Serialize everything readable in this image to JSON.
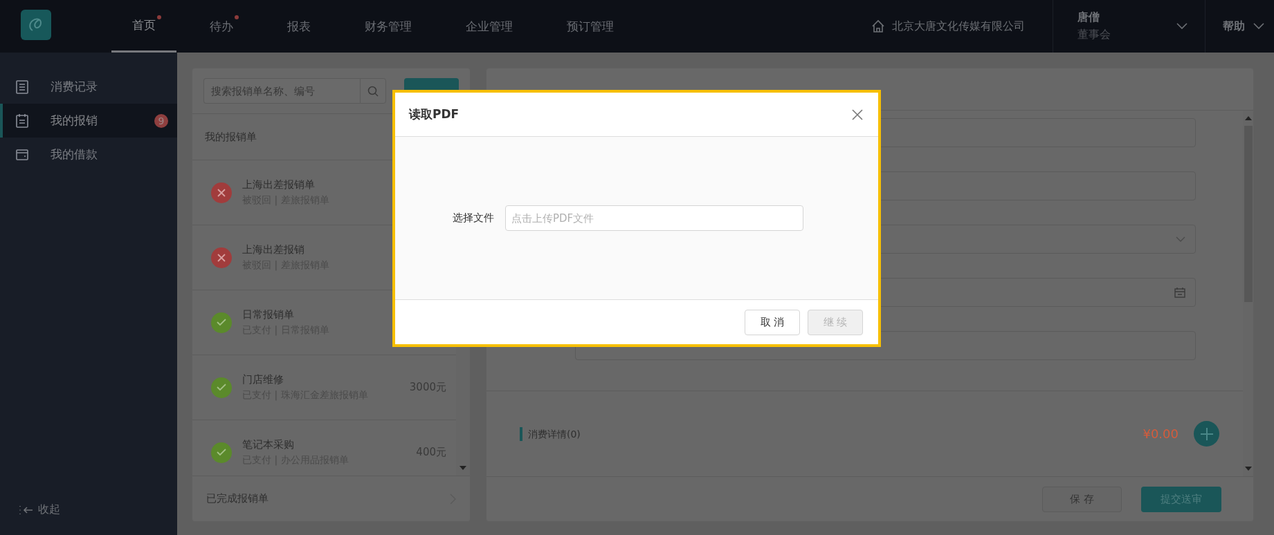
{
  "topbar": {
    "nav": [
      {
        "label": "首页",
        "selected": true,
        "dot": true
      },
      {
        "label": "待办",
        "selected": false,
        "dot": true
      },
      {
        "label": "报表",
        "selected": false,
        "dot": false
      },
      {
        "label": "财务管理",
        "selected": false,
        "dot": false
      },
      {
        "label": "企业管理",
        "selected": false,
        "dot": false
      },
      {
        "label": "预订管理",
        "selected": false,
        "dot": false
      }
    ],
    "company": "北京大唐文化传媒有限公司",
    "user": {
      "name": "唐僧",
      "role": "董事会"
    },
    "help": "帮助"
  },
  "sidebar": {
    "items": [
      {
        "label": "消费记录",
        "kind": "list",
        "selected": false
      },
      {
        "label": "我的报销",
        "kind": "clipboard",
        "selected": true,
        "badge": "9"
      },
      {
        "label": "我的借款",
        "kind": "wallet",
        "selected": false
      }
    ],
    "collapse": "收起"
  },
  "report_list": {
    "search_placeholder": "搜索报销单名称、编号",
    "section_title": "我的报销单",
    "items": [
      {
        "title": "上海出差报销单",
        "subtitle": "被驳回 | 差旅报销单",
        "kind": "rejected"
      },
      {
        "title": "上海出差报销",
        "subtitle": "被驳回 | 差旅报销单",
        "kind": "rejected"
      },
      {
        "title": "日常报销单",
        "subtitle": "已支付 | 日常报销单",
        "kind": "paid"
      },
      {
        "title": "门店维修",
        "subtitle": "已支付 | 珠海汇金差旅报销单",
        "amount": "3000元",
        "kind": "paid"
      },
      {
        "title": "笔记本采购",
        "subtitle": "已支付 | 办公用品报销单",
        "amount": "400元",
        "kind": "paid"
      }
    ],
    "footer": "已完成报销单"
  },
  "form": {
    "fields": [
      {
        "kind": "text"
      },
      {
        "kind": "text"
      },
      {
        "kind": "select"
      },
      {
        "kind": "date"
      },
      {
        "kind": "text"
      }
    ],
    "details_title": "消费详情(0)",
    "total": "¥0.00",
    "buttons": [
      {
        "label": "保 存",
        "kind": "default"
      },
      {
        "label": "提交送审",
        "kind": "primary"
      }
    ]
  },
  "dialog": {
    "title": "读取PDF",
    "field_label": "选择文件",
    "placeholder": "点击上传PDF文件",
    "buttons": [
      {
        "label": "取 消",
        "disabled": false
      },
      {
        "label": "继 续",
        "disabled": true
      }
    ]
  }
}
